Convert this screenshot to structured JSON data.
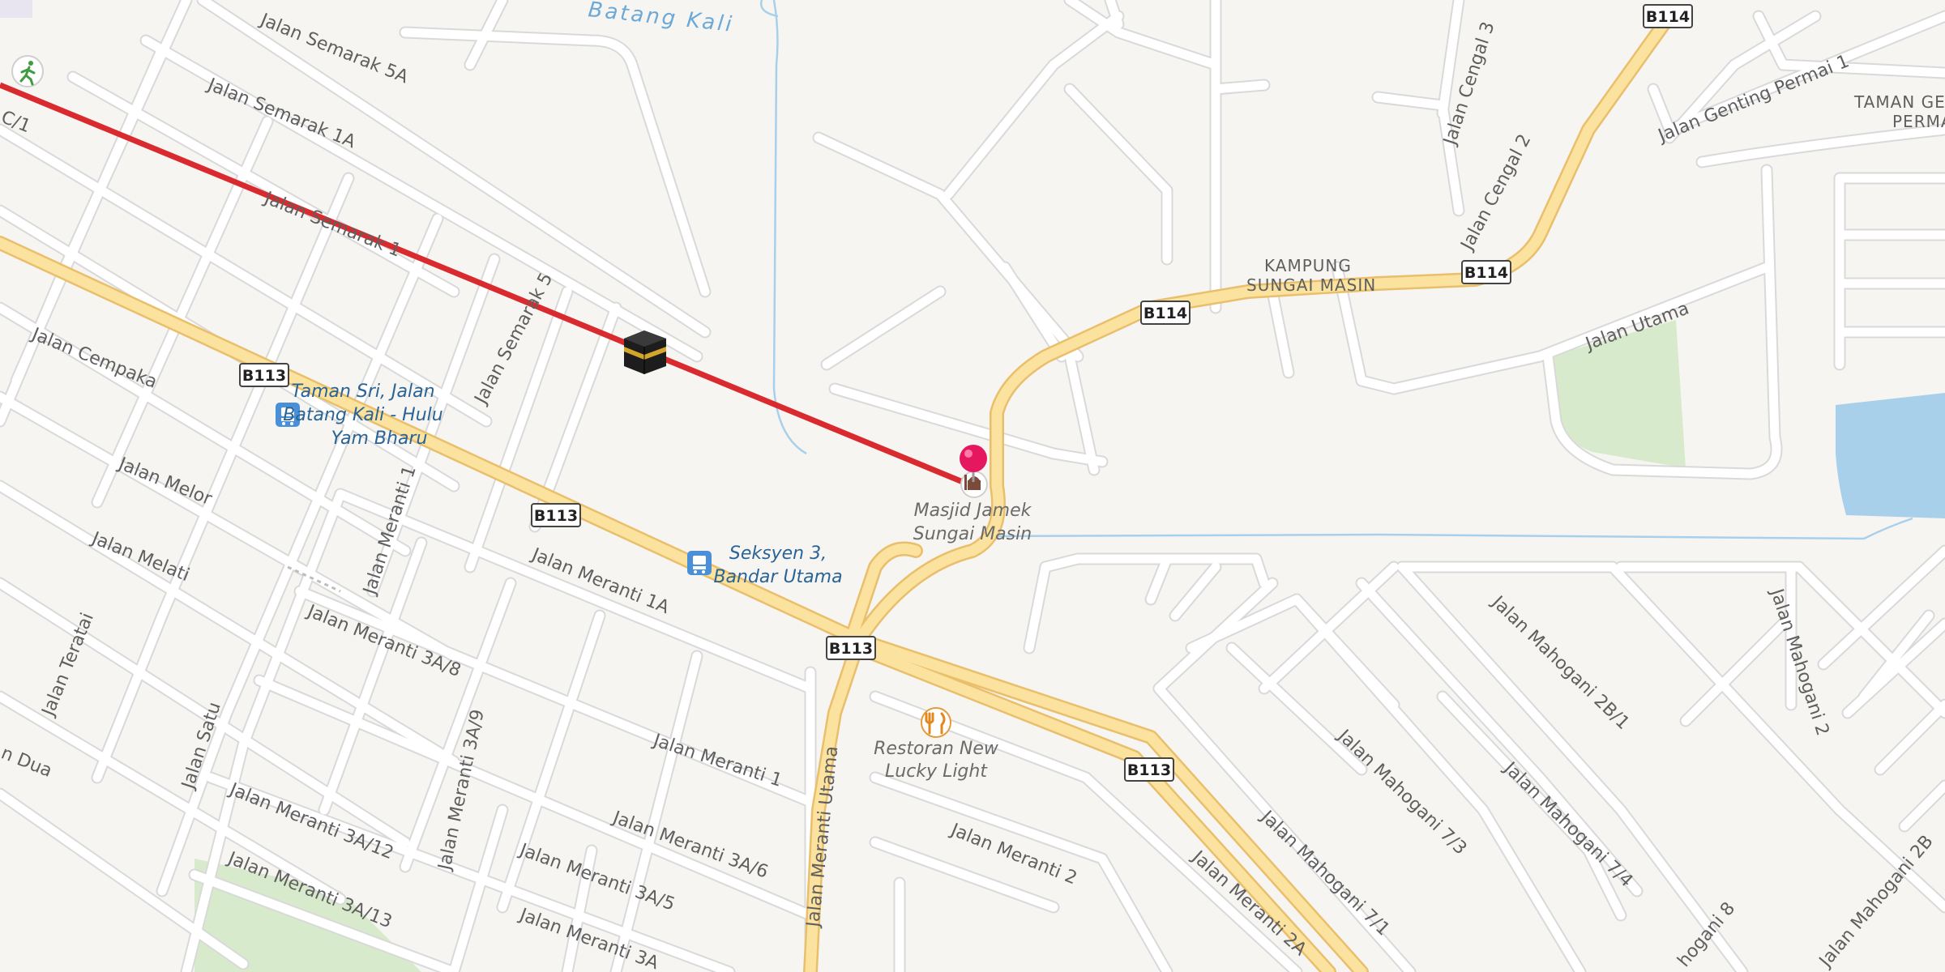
{
  "map": {
    "water_label": "Batang Kali",
    "streets": {
      "semarak_5a": "Jalan Semarak 5A",
      "semarak_1a": "Jalan Semarak 1A",
      "semarak_1": "Jalan Semarak 1",
      "semarak_5": "Jalan Semarak 5",
      "cempaka": "Jalan Cempaka",
      "melor": "Jalan Melor",
      "melati": "Jalan Melati",
      "teratai": "Jalan Teratai",
      "dua": "n Dua",
      "satu": "Jalan Satu",
      "meranti_1": "Jalan Meranti 1",
      "meranti_1_upper": "Jalan Meranti 1",
      "meranti_1a": "Jalan Meranti 1A",
      "meranti_3a8": "Jalan Meranti 3A/8",
      "meranti_3a9": "Jalan Meranti 3A/9",
      "meranti_3a12": "Jalan Meranti 3A/12",
      "meranti_3a13": "Jalan Meranti 3A/13",
      "meranti_3a6": "Jalan Meranti 3A/6",
      "meranti_3a5": "Jalan Meranti 3A/5",
      "meranti_3": "Jalan Meranti 3A",
      "meranti_2": "Jalan Meranti 2",
      "meranti_2a": "Jalan Meranti 2A",
      "meranti_utama": "Jalan Meranti Utama",
      "cengal_3": "Jalan Cengal 3",
      "cengal_2": "Jalan Cengal 2",
      "genting_permai_1": "Jalan Genting Permai 1",
      "utama": "Jalan Utama",
      "mahogani_2b1": "Jalan Mahogani 2B/1",
      "mahogani_2": "Jalan Mahogani 2",
      "mahogani_73": "Jalan Mahogani 7/3",
      "mahogani_74": "Jalan Mahogani 7/4",
      "mahogani_71": "Jalan Mahogani 7/1",
      "mahogani_8": "hogani 8",
      "mahogani_2b": "Jalan Mahogani 2B",
      "c1": "C/1"
    },
    "places": {
      "kampung_1": "KAMPUNG",
      "kampung_2": "SUNGAI MASIN",
      "taman_1": "TAMAN GEN",
      "taman_2": "PERMA"
    },
    "shields": {
      "b114_top": "B114",
      "b114_mid": "B114",
      "b114_left": "B114",
      "b113_a": "B113",
      "b113_b": "B113",
      "b113_c": "B113",
      "b113_d": "B113"
    },
    "pois": {
      "mosque_1": "Masjid Jamek",
      "mosque_2": "Sungai Masin",
      "restaurant_1": "Restoran New",
      "restaurant_2": "Lucky Light"
    },
    "transit": {
      "stop1_1": "Taman Sri, Jalan",
      "stop1_2": "Batang Kali - Hulu",
      "stop1_3": "Yam Bharu",
      "stop2_1": "Seksyen 3,",
      "stop2_2": "Bandar Utama"
    },
    "icons": {
      "kaaba": "kaaba-icon",
      "pin": "location-pin-icon",
      "mosque": "mosque-icon",
      "restaurant": "restaurant-icon",
      "bus": "bus-stop-icon",
      "hiking": "hiking-icon"
    },
    "colors": {
      "background": "#f7f5f2",
      "major_road": "#fbe29e",
      "major_road_casing": "#e9bf6c",
      "minor_road": "#ffffff",
      "minor_road_casing": "#dadada",
      "qibla_line": "#d92b2f",
      "pin": "#e5175f",
      "water": "#a9d0ea",
      "park": "#d8eacc"
    }
  }
}
